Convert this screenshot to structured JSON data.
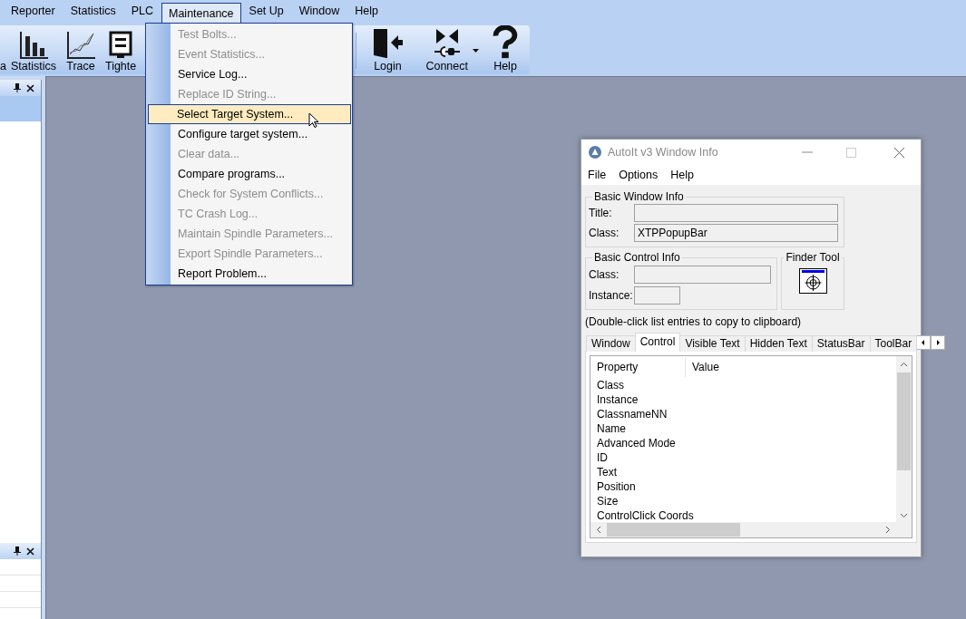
{
  "menubar": [
    {
      "label": "Reporter",
      "selected": false
    },
    {
      "label": "Statistics",
      "selected": false
    },
    {
      "label": "PLC",
      "selected": false
    },
    {
      "label": "Maintenance",
      "selected": true
    },
    {
      "label": "Set Up",
      "selected": false
    },
    {
      "label": "Window",
      "selected": false
    },
    {
      "label": "Help",
      "selected": false
    }
  ],
  "toolbar": {
    "left": [
      {
        "label": "a",
        "kind": "none"
      },
      {
        "label": "Statistics",
        "kind": "bars"
      },
      {
        "label": "Trace",
        "kind": "line"
      },
      {
        "label": "Tighte",
        "kind": "screen"
      }
    ],
    "right": [
      {
        "label": "Login",
        "kind": "door",
        "dropdown": false
      },
      {
        "label": "Connect",
        "kind": "plug",
        "dropdown": true
      },
      {
        "label": "Help",
        "kind": "question",
        "dropdown": false
      }
    ]
  },
  "menu": [
    {
      "label": "Test Bolts...",
      "disabled": true,
      "selected": false
    },
    {
      "label": "Event Statistics...",
      "disabled": true,
      "selected": false
    },
    {
      "label": "Service Log...",
      "disabled": false,
      "selected": false
    },
    {
      "label": "Replace ID String...",
      "disabled": true,
      "selected": false
    },
    {
      "label": "Select Target System...",
      "disabled": false,
      "selected": true
    },
    {
      "label": "Configure target system...",
      "disabled": false,
      "selected": false
    },
    {
      "label": "Clear data...",
      "disabled": true,
      "selected": false
    },
    {
      "label": "Compare programs...",
      "disabled": false,
      "selected": false
    },
    {
      "label": "Check for System Conflicts...",
      "disabled": true,
      "selected": false
    },
    {
      "label": "TC Crash Log...",
      "disabled": true,
      "selected": false
    },
    {
      "label": "Maintain Spindle Parameters...",
      "disabled": true,
      "selected": false
    },
    {
      "label": "Export Spindle Parameters...",
      "disabled": true,
      "selected": false
    },
    {
      "label": "Report Problem...",
      "disabled": false,
      "selected": false
    }
  ],
  "autoit_window": {
    "title": "AutoIt v3 Window Info",
    "menu": [
      "File",
      "Options",
      "Help"
    ],
    "basic_window_info": {
      "title": "Basic Window Info",
      "fields": [
        {
          "label": "Title:"
        },
        {
          "label": "Class:",
          "value": "XTPPopupBar"
        }
      ]
    },
    "basic_control_info": {
      "title": "Basic Control Info",
      "fields": [
        {
          "label": "Class:"
        },
        {
          "label": "Instance:"
        }
      ]
    },
    "finder_tool": {
      "title": "Finder Tool"
    },
    "hint": "(Double-click list entries to copy to clipboard)",
    "tabs": [
      {
        "label": "Window",
        "selected": false
      },
      {
        "label": "Control",
        "selected": true
      },
      {
        "label": "Visible Text",
        "selected": false
      },
      {
        "label": "Hidden Text",
        "selected": false
      },
      {
        "label": "StatusBar",
        "selected": false
      },
      {
        "label": "ToolBar",
        "selected": false
      }
    ],
    "table": {
      "columns": [
        "Property",
        "Value"
      ],
      "rows": [
        "Class",
        "Instance",
        "ClassnameNN",
        "Name",
        "Advanced Mode",
        "ID",
        "Text",
        "Position",
        "Size",
        "ControlClick Coords"
      ]
    }
  }
}
